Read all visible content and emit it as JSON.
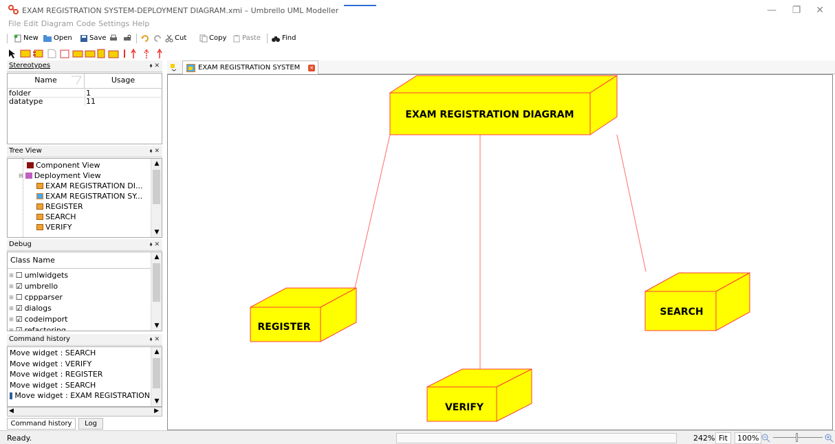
{
  "window": {
    "title": "EXAM REGISTRATION SYSTEM-DEPLOYMENT DIAGRAM.xmi – Umbrello UML Modeller",
    "minimize": "—",
    "restore": "❐",
    "close": "✕"
  },
  "menu": [
    "File",
    "Edit",
    "Diagram",
    "Code",
    "Settings",
    "Help"
  ],
  "toolbar": {
    "new": "New",
    "open": "Open",
    "save": "Save",
    "cut": "Cut",
    "copy": "Copy",
    "paste": "Paste",
    "find": "Find"
  },
  "stereotypes": {
    "title": "Stereotypes",
    "col_name": "Name",
    "col_usage": "Usage",
    "rows": [
      {
        "name": "folder",
        "usage": "1"
      },
      {
        "name": "datatype",
        "usage": "11"
      }
    ]
  },
  "tree_view": {
    "title": "Tree View",
    "items": [
      "Component View",
      "Deployment View",
      "EXAM REGISTRATION DI...",
      "EXAM REGISTRATION SY...",
      "REGISTER",
      "SEARCH",
      "VERIFY"
    ]
  },
  "debug": {
    "title": "Debug",
    "column": "Class Name",
    "items": [
      {
        "name": "umlwidgets",
        "checked": false
      },
      {
        "name": "umbrello",
        "checked": true
      },
      {
        "name": "cppparser",
        "checked": false
      },
      {
        "name": "dialogs",
        "checked": true
      },
      {
        "name": "codeimport",
        "checked": true
      },
      {
        "name": "refactoring",
        "checked": true
      }
    ]
  },
  "command_history": {
    "title": "Command history",
    "items": [
      "Move widget : SEARCH",
      "Move widget : VERIFY",
      "Move widget : REGISTER",
      "Move widget : SEARCH",
      "Move widget : EXAM REGISTRATION"
    ],
    "tabs": [
      "Command history",
      "Log"
    ]
  },
  "diagram_tab": {
    "label": "EXAM REGISTRATION SYSTEM"
  },
  "diagram": {
    "nodes": {
      "main": "EXAM REGISTRATION DIAGRAM",
      "register": "REGISTER",
      "verify": "VERIFY",
      "search": "SEARCH"
    },
    "node_fill": "#ffff00",
    "node_stroke": "#ff3b3b",
    "edge_color": "#ff6b6b"
  },
  "status": {
    "text": "Ready.",
    "zoom": "242%",
    "fit": "Fit",
    "hundred": "100%"
  }
}
